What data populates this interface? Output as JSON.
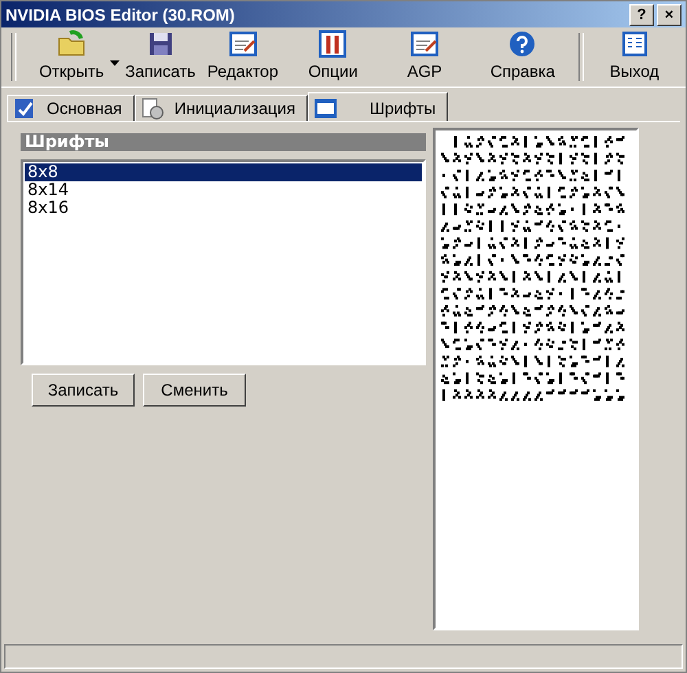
{
  "window": {
    "title": "NVIDIA BIOS Editor (30.ROM)",
    "buttons": [
      "?",
      "×"
    ]
  },
  "toolbar": [
    {
      "label": "Открыть",
      "kind": "open",
      "dropdown": true
    },
    {
      "label": "Записать",
      "kind": "save",
      "dropdown": false
    },
    {
      "label": "Редактор",
      "kind": "editor",
      "dropdown": false
    },
    {
      "label": "Опции",
      "kind": "options",
      "dropdown": false
    },
    {
      "label": "AGP",
      "kind": "editor",
      "dropdown": false
    },
    {
      "label": "Справка",
      "kind": "help",
      "dropdown": false
    },
    {
      "label": "Выход",
      "kind": "exit",
      "dropdown": false
    }
  ],
  "tabs": [
    {
      "label": "Основная",
      "kind": "main",
      "selected": false
    },
    {
      "label": "Инициализация",
      "kind": "init",
      "selected": false
    },
    {
      "label": "Шрифты",
      "kind": "fonts",
      "selected": true
    }
  ],
  "fonts_panel": {
    "title": "Шрифты",
    "items": [
      {
        "label": "8x8",
        "selected": true
      },
      {
        "label": "8x14",
        "selected": false
      },
      {
        "label": "8x16",
        "selected": false
      }
    ],
    "buttons": [
      "Записать",
      "Сменить"
    ]
  }
}
